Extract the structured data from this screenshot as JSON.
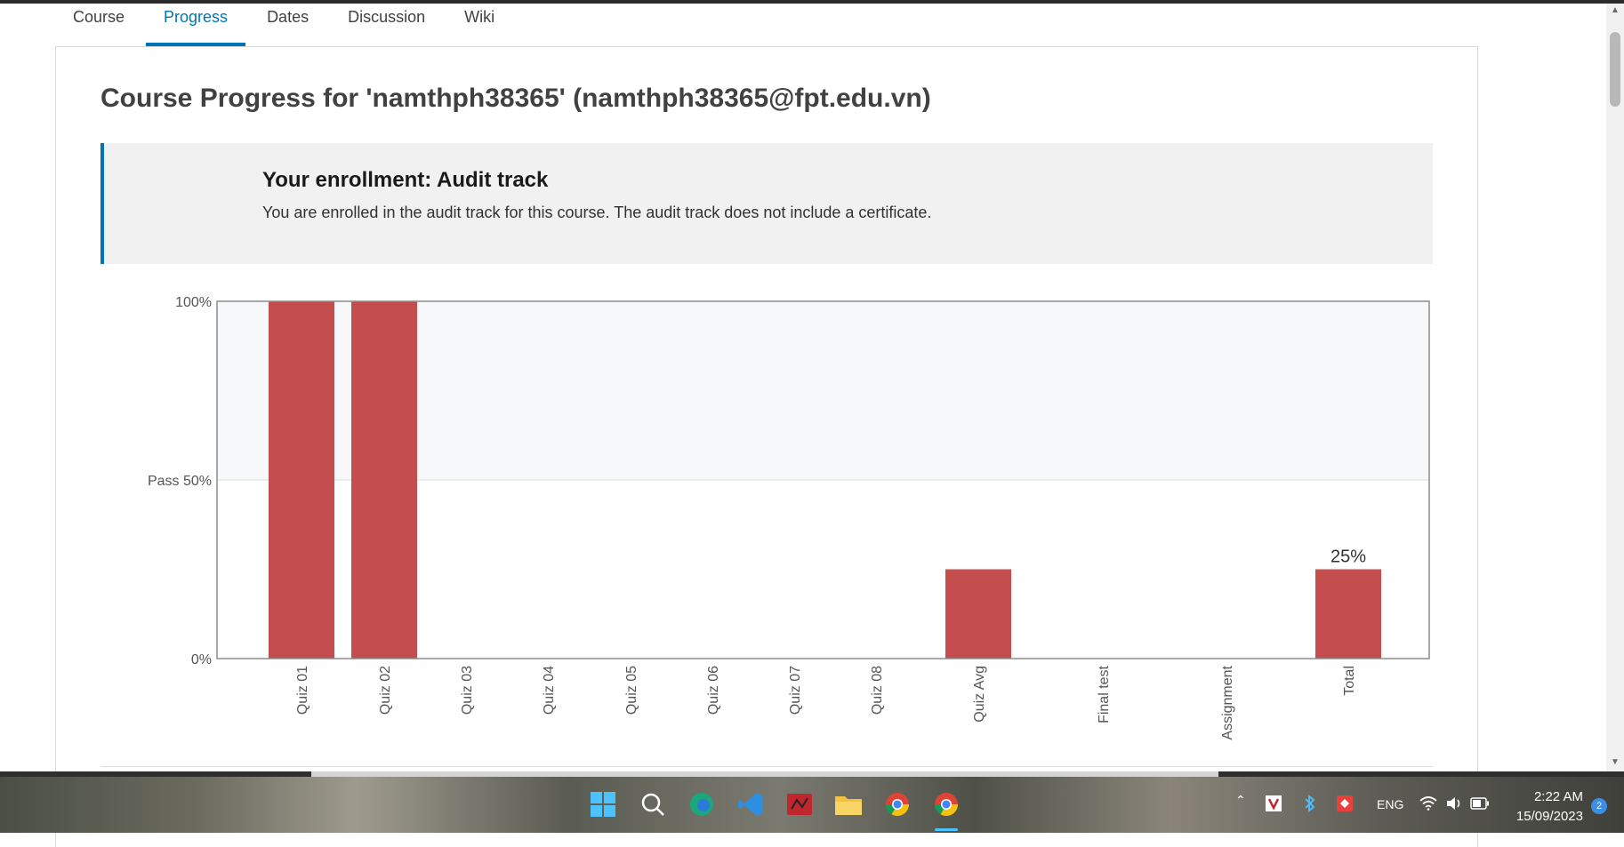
{
  "tabs": [
    {
      "label": "Course",
      "active": false
    },
    {
      "label": "Progress",
      "active": true
    },
    {
      "label": "Dates",
      "active": false
    },
    {
      "label": "Discussion",
      "active": false
    },
    {
      "label": "Wiki",
      "active": false
    }
  ],
  "page_title": "Course Progress for 'namthph38365' (namthph38365@fpt.edu.vn)",
  "enrollment": {
    "title": "Your enrollment: Audit track",
    "text": "You are enrolled in the audit track for this course. The audit track does not include a certificate."
  },
  "chart_data": {
    "type": "bar",
    "categories": [
      "Quiz 01",
      "Quiz 02",
      "Quiz 03",
      "Quiz 04",
      "Quiz 05",
      "Quiz 06",
      "Quiz 07",
      "Quiz 08",
      "Quiz Avg",
      "Final test",
      "Assignment",
      "Total"
    ],
    "values": [
      100,
      100,
      0,
      0,
      0,
      0,
      0,
      0,
      25,
      0,
      0,
      25
    ],
    "ylim": [
      0,
      100
    ],
    "yticks": [
      {
        "value": 100,
        "label": "100%"
      },
      {
        "value": 50,
        "label": "Pass 50%"
      },
      {
        "value": 0,
        "label": "0%"
      }
    ],
    "pass_threshold": 50,
    "data_labels": [
      {
        "category": "Total",
        "text": "25%"
      }
    ],
    "bar_color": "#c44d4d",
    "pass_zone_color": "#f7f8fa"
  },
  "taskbar": {
    "language": "ENG",
    "time": "2:22 AM",
    "date": "15/09/2023",
    "notification_count": "2",
    "icons": [
      "windows-start-icon",
      "search-icon",
      "edge-browser-icon",
      "vscode-icon",
      "app-icon",
      "file-explorer-icon",
      "chrome-icon",
      "chrome-profile-icon"
    ]
  },
  "colors": {
    "accent": "#0075b4",
    "bar": "#c44d4d"
  }
}
